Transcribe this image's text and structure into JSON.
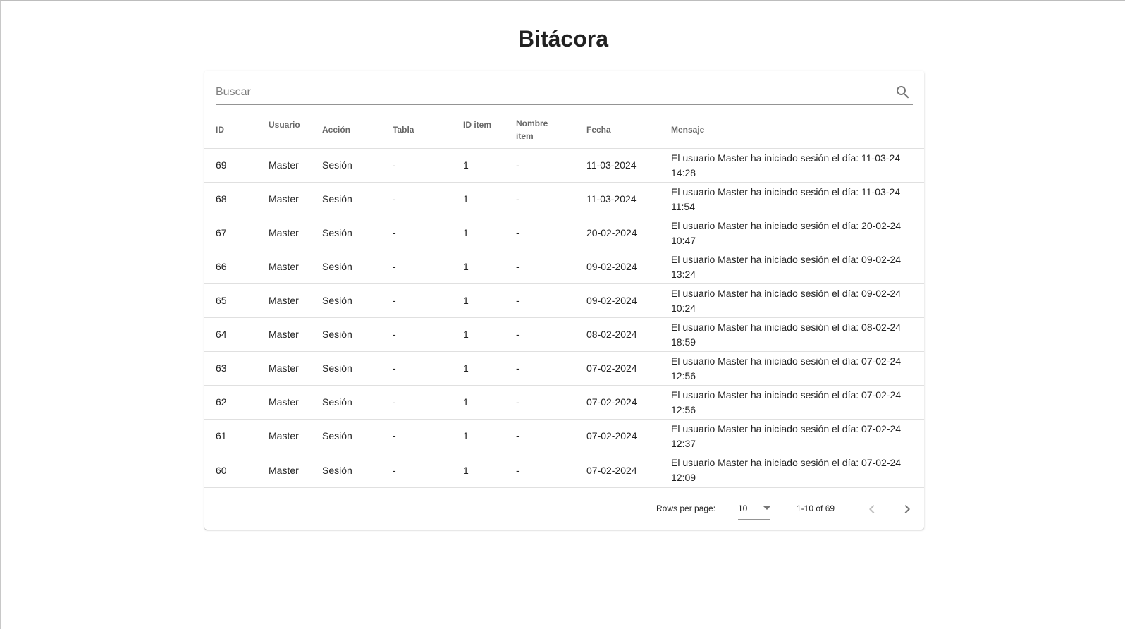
{
  "page": {
    "title": "Bitácora"
  },
  "search": {
    "placeholder": "Buscar",
    "value": ""
  },
  "table": {
    "headers": {
      "id": "ID",
      "usuario": "Usuario",
      "accion": "Acción",
      "tabla": "Tabla",
      "id_item": "ID item",
      "nombre_item_1": "Nombre",
      "nombre_item_2": "item",
      "fecha": "Fecha",
      "mensaje": "Mensaje"
    },
    "rows": [
      {
        "id": "69",
        "usuario": "Master",
        "accion": "Sesión",
        "tabla": "-",
        "id_item": "1",
        "nombre_item": "-",
        "fecha": "11-03-2024",
        "mensaje": "El usuario Master ha iniciado sesión el día: 11-03-24 14:28"
      },
      {
        "id": "68",
        "usuario": "Master",
        "accion": "Sesión",
        "tabla": "-",
        "id_item": "1",
        "nombre_item": "-",
        "fecha": "11-03-2024",
        "mensaje": "El usuario Master ha iniciado sesión el día: 11-03-24 11:54"
      },
      {
        "id": "67",
        "usuario": "Master",
        "accion": "Sesión",
        "tabla": "-",
        "id_item": "1",
        "nombre_item": "-",
        "fecha": "20-02-2024",
        "mensaje": "El usuario Master ha iniciado sesión el día: 20-02-24 10:47"
      },
      {
        "id": "66",
        "usuario": "Master",
        "accion": "Sesión",
        "tabla": "-",
        "id_item": "1",
        "nombre_item": "-",
        "fecha": "09-02-2024",
        "mensaje": "El usuario Master ha iniciado sesión el día: 09-02-24 13:24"
      },
      {
        "id": "65",
        "usuario": "Master",
        "accion": "Sesión",
        "tabla": "-",
        "id_item": "1",
        "nombre_item": "-",
        "fecha": "09-02-2024",
        "mensaje": "El usuario Master ha iniciado sesión el día: 09-02-24 10:24"
      },
      {
        "id": "64",
        "usuario": "Master",
        "accion": "Sesión",
        "tabla": "-",
        "id_item": "1",
        "nombre_item": "-",
        "fecha": "08-02-2024",
        "mensaje": "El usuario Master ha iniciado sesión el día: 08-02-24 18:59"
      },
      {
        "id": "63",
        "usuario": "Master",
        "accion": "Sesión",
        "tabla": "-",
        "id_item": "1",
        "nombre_item": "-",
        "fecha": "07-02-2024",
        "mensaje": "El usuario Master ha iniciado sesión el día: 07-02-24 12:56"
      },
      {
        "id": "62",
        "usuario": "Master",
        "accion": "Sesión",
        "tabla": "-",
        "id_item": "1",
        "nombre_item": "-",
        "fecha": "07-02-2024",
        "mensaje": "El usuario Master ha iniciado sesión el día: 07-02-24 12:56"
      },
      {
        "id": "61",
        "usuario": "Master",
        "accion": "Sesión",
        "tabla": "-",
        "id_item": "1",
        "nombre_item": "-",
        "fecha": "07-02-2024",
        "mensaje": "El usuario Master ha iniciado sesión el día: 07-02-24 12:37"
      },
      {
        "id": "60",
        "usuario": "Master",
        "accion": "Sesión",
        "tabla": "-",
        "id_item": "1",
        "nombre_item": "-",
        "fecha": "07-02-2024",
        "mensaje": "El usuario Master ha iniciado sesión el día: 07-02-24 12:09"
      }
    ]
  },
  "pagination": {
    "rows_per_page_label": "Rows per page:",
    "rows_per_page_value": "10",
    "range_label": "1-10 of 69"
  },
  "icons": {
    "search": "search-icon",
    "dropdown": "caret-down-icon",
    "prev": "chevron-left-icon",
    "next": "chevron-right-icon"
  }
}
